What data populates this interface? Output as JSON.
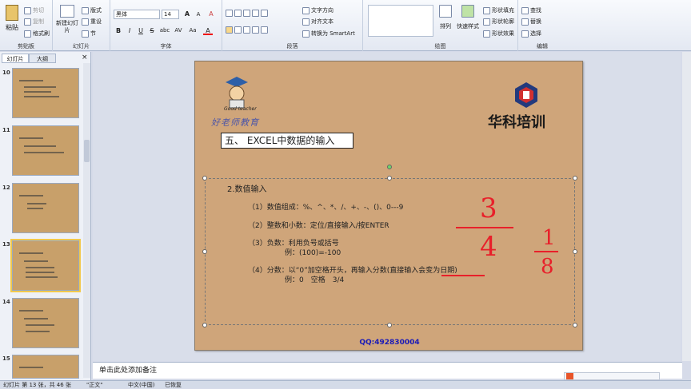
{
  "ribbon": {
    "clipboard": {
      "paste": "粘贴",
      "cut": "剪切",
      "copy": "复制",
      "painter": "格式刷",
      "label": "剪贴板"
    },
    "slides": {
      "new_slide": "新建幻灯片",
      "layout": "版式",
      "reset": "重设",
      "section": "节",
      "label": "幻灯片"
    },
    "font": {
      "name": "黑体",
      "size": "14",
      "label": "字体",
      "bold": "B",
      "italic": "I",
      "underline": "U",
      "strike": "S",
      "shadow": "abc",
      "spacing": "AV",
      "case": "Aa",
      "color": "A",
      "grow": "A",
      "shrink": "A",
      "clear": "A"
    },
    "paragraph": {
      "text_direction": "文字方向",
      "align_text": "对齐文本",
      "smartart": "转换为 SmartArt",
      "label": "段落"
    },
    "drawing": {
      "arrange": "排列",
      "quick_styles": "快速样式",
      "fill": "形状填充",
      "outline": "形状轮廓",
      "effects": "形状效果",
      "label": "绘图"
    },
    "editing": {
      "find": "查找",
      "replace": "替换",
      "select": "选择",
      "label": "编辑"
    }
  },
  "panel": {
    "tab_slides": "幻灯片",
    "tab_outline": "大纲",
    "close": "×",
    "thumbs": [
      {
        "num": "10"
      },
      {
        "num": "11"
      },
      {
        "num": "12"
      },
      {
        "num": "13"
      },
      {
        "num": "14"
      },
      {
        "num": "15"
      }
    ]
  },
  "slide": {
    "logo_caption": "Good teacher",
    "logo_name": "好老师教育",
    "brand": "华科培训",
    "title": "五、 EXCEL中数据的输入",
    "heading": "2.数值输入",
    "items": [
      "（1）数值组成：%、^、*、/、+、-、()、0---9",
      "（2）整数和小数：定位/直接输入/按ENTER",
      "（3）负数：利用负号或括号",
      "例：(100)=-100",
      "（4）分数：以“0”加空格开头，再输入分数(直接输入会变为日期)",
      "例：0　空格　3/4"
    ],
    "hand": {
      "a_num": "3",
      "a_den": "4",
      "b_num": "1",
      "b_den": "8"
    },
    "qq": "QQ:492830004",
    "colors": {
      "bg": "#cfa57a",
      "ink": "#e8202a",
      "qq": "#1a1ab8"
    }
  },
  "notes": {
    "placeholder": "单击此处添加备注"
  },
  "status": {
    "slide": "幻灯片 第 13 张，共 46 张",
    "theme": "\"正文\"",
    "lang": "中文(中国)",
    "state": "已恢复"
  }
}
